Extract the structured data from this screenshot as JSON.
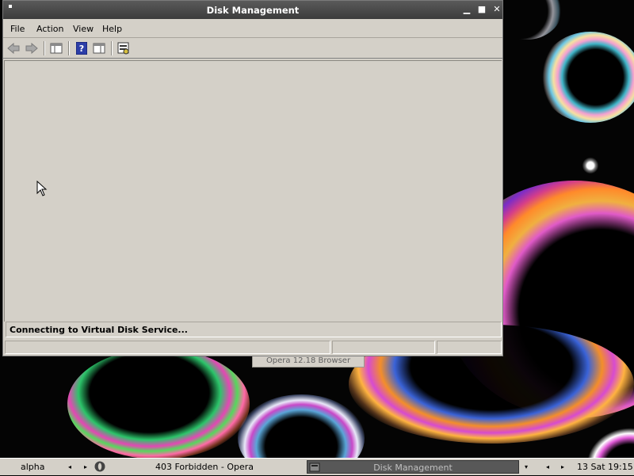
{
  "window": {
    "title": "Disk Management",
    "controls": {
      "minimize": "▁",
      "maximize": "■",
      "close": "✕"
    }
  },
  "menu": {
    "items": [
      {
        "label": "File"
      },
      {
        "label": "Action"
      },
      {
        "label": "View"
      },
      {
        "label": "Help"
      }
    ]
  },
  "toolbar": {
    "icons": [
      "back-arrow-icon",
      "forward-arrow-icon",
      "show-hide-console-tree-icon",
      "help-icon",
      "show-hide-action-pane-icon",
      "properties-icon"
    ]
  },
  "status": {
    "message": "Connecting to Virtual Disk Service..."
  },
  "background_window": {
    "tooltip": "Opera 12.18 Browser"
  },
  "taskbar": {
    "workspace": "alpha",
    "tasks": [
      {
        "label": "403 Forbidden - Opera"
      },
      {
        "label": "Disk Management"
      }
    ],
    "clock": "13 Sat 19:15"
  },
  "colors": {
    "window_bg": "#d4d0c8",
    "titlebar": "#4a4a4a",
    "active_task": "#585858"
  }
}
